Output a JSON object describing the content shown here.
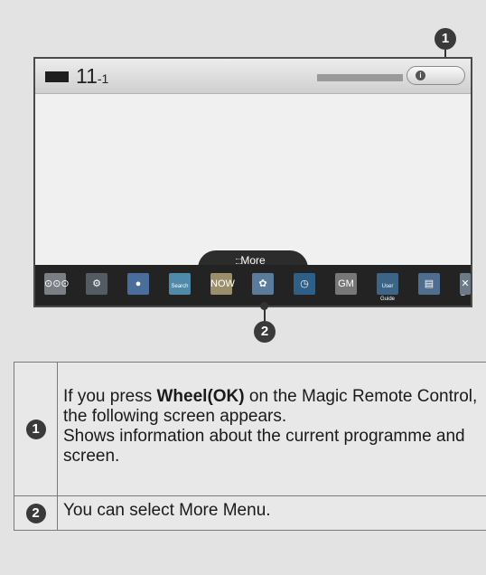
{
  "callouts": {
    "one": "1",
    "two": "2"
  },
  "screen": {
    "channel": {
      "number": "11",
      "sub": "-1"
    },
    "info_icon": "i",
    "more_label": "More",
    "menu_items": [
      {
        "name": "input-devices-icon",
        "glyph": "⊙⊙⊙",
        "color": "#7a7f86"
      },
      {
        "name": "settings-gear-icon",
        "glyph": "⚙",
        "color": "#555b62"
      },
      {
        "name": "internet-globe-icon",
        "glyph": "●",
        "color": "#4a6d9b"
      },
      {
        "name": "search-icon",
        "glyph": "Search",
        "color": "#4f8aa8"
      },
      {
        "name": "now-and-hot-icon",
        "glyph": "NOW",
        "color": "#9c8e6a"
      },
      {
        "name": "connections-icon",
        "glyph": "✿",
        "color": "#5b7b9c"
      },
      {
        "name": "clock-icon",
        "glyph": "◷",
        "color": "#2d5f87"
      },
      {
        "name": "game-icon",
        "glyph": "GM",
        "color": "#777777"
      },
      {
        "name": "user-guide-icon",
        "glyph": "User Guide",
        "color": "#3b6487"
      },
      {
        "name": "picture-settings-icon",
        "glyph": "▤",
        "color": "#4f6d8e"
      },
      {
        "name": "more-app-icon",
        "glyph": "✕",
        "color": "#6a7a88"
      }
    ],
    "next_chevron": "❯"
  },
  "table": {
    "rows": [
      {
        "badge": "1",
        "text_before_bold": "If you press ",
        "bold": "Wheel(OK)",
        "text_after_bold": " on the Magic Remote Control, the following screen appears.",
        "line2": "Shows information about the current programme and screen."
      },
      {
        "badge": "2",
        "text": "You can select More Menu."
      }
    ]
  }
}
